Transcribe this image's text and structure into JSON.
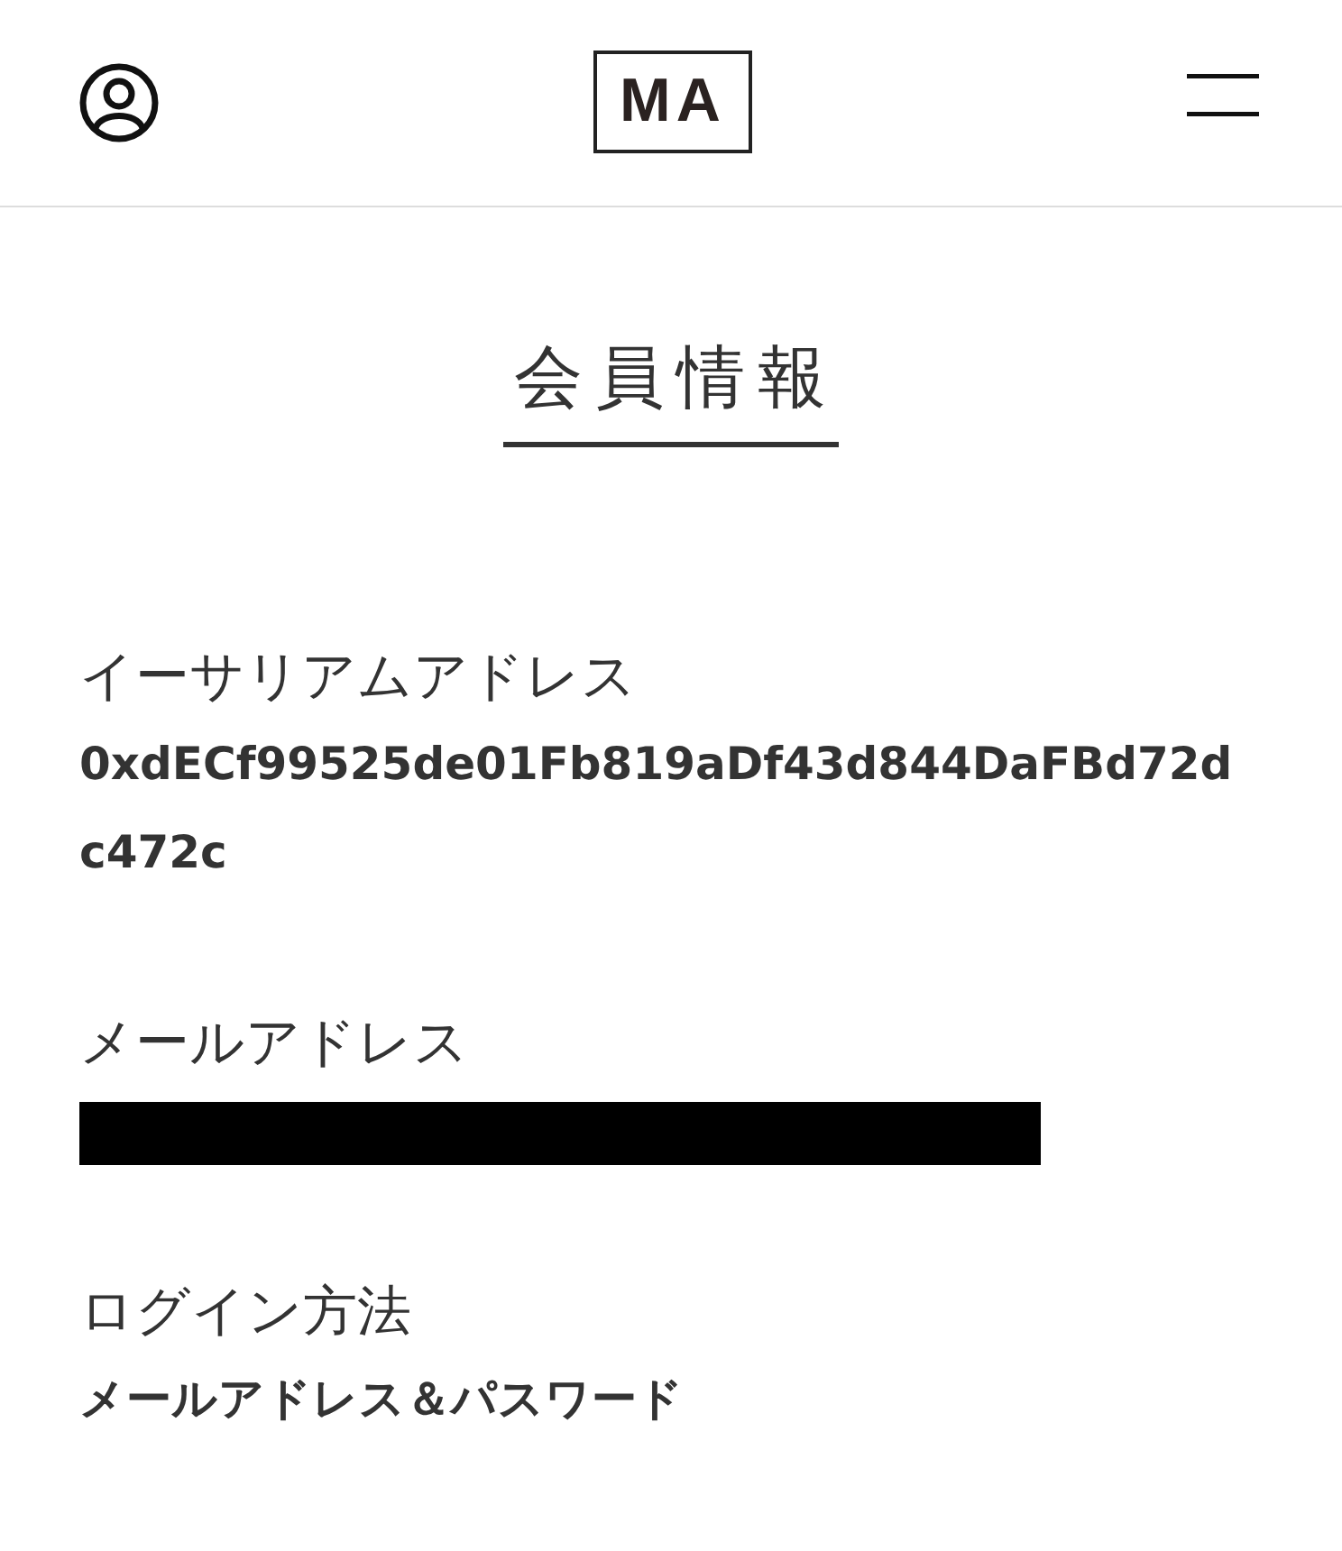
{
  "header": {
    "logo": "MA"
  },
  "page_title": "会員情報",
  "fields": [
    {
      "kind": "text",
      "label": "イーサリアムアドレス",
      "value": "0xdECf99525de01Fb819aDf43d844DaFBd72dc472c"
    },
    {
      "kind": "redacted",
      "label": "メールアドレス"
    },
    {
      "kind": "text",
      "label": "ログイン方法",
      "value": "メールアドレス＆パスワード"
    }
  ]
}
